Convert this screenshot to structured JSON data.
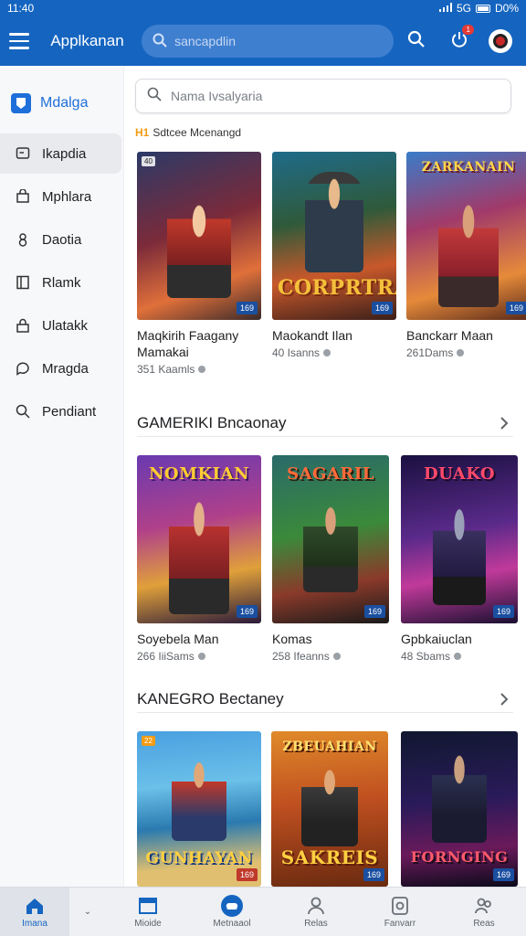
{
  "status_bar": {
    "time": "11:40",
    "network": "5G",
    "battery": "D0%"
  },
  "app_bar": {
    "title": "Applkanan",
    "search_placeholder": "sancapdlin",
    "notification_count": "1"
  },
  "sidebar": {
    "brand": "Mdalga",
    "items": [
      {
        "label": "Ikapdia",
        "icon": "chat-box-icon",
        "active": true
      },
      {
        "label": "Mphlara",
        "icon": "bag-icon",
        "active": false
      },
      {
        "label": "Daotia",
        "icon": "circle-user-icon",
        "active": false
      },
      {
        "label": "Rlamk",
        "icon": "book-icon",
        "active": false
      },
      {
        "label": "Ulatakk",
        "icon": "lock-icon",
        "active": false
      },
      {
        "label": "Mragda",
        "icon": "chat-bubble-icon",
        "active": false
      },
      {
        "label": "Pendiant",
        "icon": "search-icon",
        "active": false
      }
    ]
  },
  "main": {
    "search_placeholder": "Nama Ivsalyaria",
    "featured_label": "Sdtcee Mcenangd",
    "featured_tag": "H1",
    "sections": [
      {
        "games": [
          {
            "title": "Maqkirih Faagany Mamakai",
            "meta": "351 Kaamls",
            "art_title": "",
            "price": "169",
            "corner": "40"
          },
          {
            "title": "Maokandt Ilan",
            "meta": "40 Isanns",
            "art_title": "CORPRTRA",
            "price": "169",
            "corner": ""
          },
          {
            "title": "Banckarr Maan",
            "meta": "261Dams",
            "art_title": "ZARKANAIN",
            "price": "169",
            "corner": ""
          }
        ]
      },
      {
        "title": "GAMERIKI Bncaonay",
        "games": [
          {
            "title": "Soyebela Man",
            "meta": "266 IiiSams",
            "art_title": "NOMKIAN",
            "price": "169",
            "corner": ""
          },
          {
            "title": "Komas",
            "meta": "258 Ifeanns",
            "art_title": "SAGARIL",
            "price": "169",
            "corner": ""
          },
          {
            "title": "Gpbkaiuclan",
            "meta": "48 Sbams",
            "art_title": "DUAKO",
            "price": "169",
            "corner": ""
          }
        ]
      },
      {
        "title": "KANEGRO Bectaney",
        "games": [
          {
            "title": "",
            "meta": "",
            "art_title": "GUNHAYAN",
            "price": "169",
            "corner": "22"
          },
          {
            "title": "",
            "meta": "",
            "art_title": "SAKREIS",
            "price": "169",
            "corner": ""
          },
          {
            "title": "",
            "meta": "",
            "art_title": "FORNGING",
            "price": "169",
            "corner": ""
          }
        ]
      }
    ]
  },
  "bottom_nav": [
    {
      "label": "Imana",
      "icon": "home-icon",
      "active": true
    },
    {
      "label": "Mioide",
      "icon": "library-icon",
      "active": false
    },
    {
      "label": "Metnaaol",
      "icon": "gamepad-icon",
      "active": false
    },
    {
      "label": "Relas",
      "icon": "profile-icon",
      "active": false
    },
    {
      "label": "Fanvarr",
      "icon": "device-icon",
      "active": false
    },
    {
      "label": "Reas",
      "icon": "group-icon",
      "active": false
    }
  ],
  "colors": {
    "accent": "#1565c0",
    "brand": "#1e6fd9",
    "price_badge": "#1a4fa0"
  }
}
